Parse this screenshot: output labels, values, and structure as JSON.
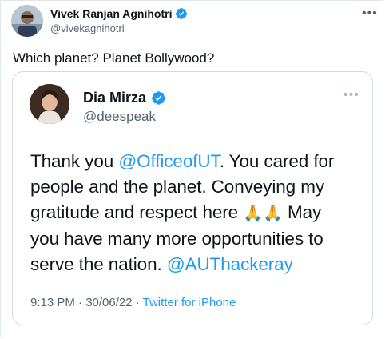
{
  "outer_tweet": {
    "author_name": "Vivek Ranjan Agnihotri",
    "author_handle": "@vivekagnihotri",
    "text": "Which planet? Planet Bollywood?",
    "more_label": "•••"
  },
  "quoted_tweet": {
    "author_name": "Dia Mirza",
    "author_handle": "@deespeak",
    "more_label": "•••",
    "body": {
      "line1_a": "Thank you ",
      "line1_mention": "@OfficeofUT",
      "line1_b": ". You cared for",
      "line2": "people and the planet. Conveying my",
      "line3_a": "gratitude and respect here ",
      "line3_emoji": "🙏🙏",
      "line3_b": " May",
      "line4": "you have many more opportunities to",
      "line5_a": "serve the nation.  ",
      "line5_mention": "@AUThackeray"
    },
    "timestamp": "9:13 PM · 30/06/22 · ",
    "source": "Twitter for iPhone"
  },
  "colors": {
    "link": "#1d9bf0",
    "verified": "#1d9bf0",
    "secondary_text": "#536471"
  }
}
